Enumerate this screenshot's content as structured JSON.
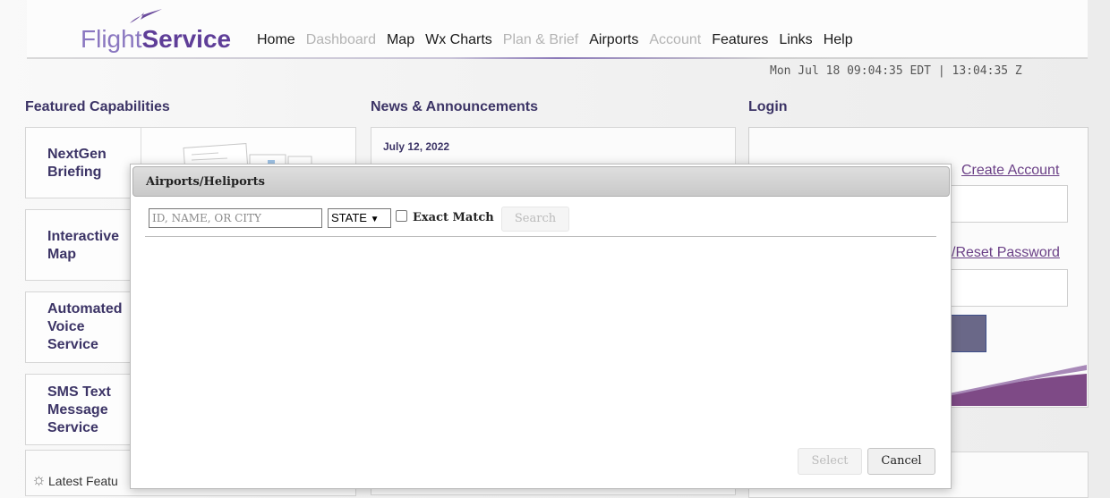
{
  "header": {
    "logo_light": "Flight",
    "logo_bold": "Service",
    "nav": [
      {
        "label": "Home",
        "enabled": true
      },
      {
        "label": "Dashboard",
        "enabled": false
      },
      {
        "label": "Map",
        "enabled": true
      },
      {
        "label": "Wx Charts",
        "enabled": true
      },
      {
        "label": "Plan & Brief",
        "enabled": false
      },
      {
        "label": "Airports",
        "enabled": true
      },
      {
        "label": "Account",
        "enabled": false
      },
      {
        "label": "Features",
        "enabled": true
      },
      {
        "label": "Links",
        "enabled": true
      },
      {
        "label": "Help",
        "enabled": true
      }
    ],
    "clock": "Mon Jul 18 09:04:35 EDT | 13:04:35 Z"
  },
  "featured": {
    "title": "Featured Capabilities",
    "cards": [
      {
        "label_lines": [
          "NextGen",
          "Briefing"
        ]
      },
      {
        "label_lines": [
          "Interactive",
          "Map"
        ]
      },
      {
        "label_lines": [
          "Automated",
          "Voice",
          "Service"
        ]
      },
      {
        "label_lines": [
          "SMS Text",
          "Message",
          "Service"
        ]
      }
    ],
    "latest": "Latest Featu"
  },
  "news": {
    "title": "News & Announcements",
    "date": "July 12, 2022"
  },
  "login": {
    "title": "Login",
    "create_account": "Create Account",
    "reset_password": "/Reset Password"
  },
  "modal": {
    "title": "Airports/Heliports",
    "search_placeholder": "ID, NAME, OR CITY",
    "state_label": "STATE",
    "exact_match_label": "Exact Match",
    "search_button": "Search",
    "select_button": "Select",
    "cancel_button": "Cancel"
  },
  "colors": {
    "brand_purple": "#5f3e98",
    "heading": "#3c3466",
    "link": "#6a3f86"
  }
}
